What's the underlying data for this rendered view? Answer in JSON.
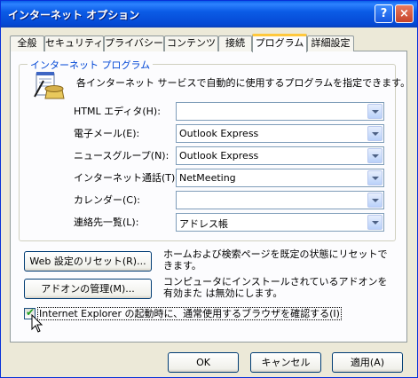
{
  "window": {
    "title": "インターネット オプション",
    "help_glyph": "?",
    "close_glyph": "×"
  },
  "tabs": [
    {
      "label": "全般"
    },
    {
      "label": "セキュリティ"
    },
    {
      "label": "プライバシー"
    },
    {
      "label": "コンテンツ"
    },
    {
      "label": "接続"
    },
    {
      "label": "プログラム",
      "active": true
    },
    {
      "label": "詳細設定"
    }
  ],
  "programs": {
    "group_title": "インターネット プログラム",
    "description": "各インターネット サービスで自動的に使用するプログラムを指定できます。",
    "rows": [
      {
        "label": "HTML エディタ(H):",
        "value": ""
      },
      {
        "label": "電子メール(E):",
        "value": "Outlook Express"
      },
      {
        "label": "ニュースグループ(N):",
        "value": "Outlook Express"
      },
      {
        "label": "インターネット通話(T):",
        "value": "NetMeeting"
      },
      {
        "label": "カレンダー(C):",
        "value": ""
      },
      {
        "label": "連絡先一覧(L):",
        "value": "アドレス帳"
      }
    ]
  },
  "reset_web": {
    "button_label": "Web 設定のリセット(R)...",
    "description": "ホームおよび検索ページを既定の状態にリセットできます。"
  },
  "addons": {
    "button_label": "アドオンの管理(M)...",
    "description": "コンピュータにインストールされているアドオンを有効また は無効にします。"
  },
  "default_browser_check": {
    "label": "Internet Explorer の起動時に、通常使用するブラウザを確認する(I)",
    "checked": true
  },
  "footer": {
    "ok_label": "OK",
    "cancel_label": "キャンセル",
    "apply_label": "適用(A)"
  },
  "colors": {
    "titlebar": "#0A5FE8",
    "dialog_bg": "#ECE9D8",
    "panel_bg": "#FCFCFE",
    "group_title": "#0046D5",
    "active_tab_accent": "#FFC83C"
  }
}
